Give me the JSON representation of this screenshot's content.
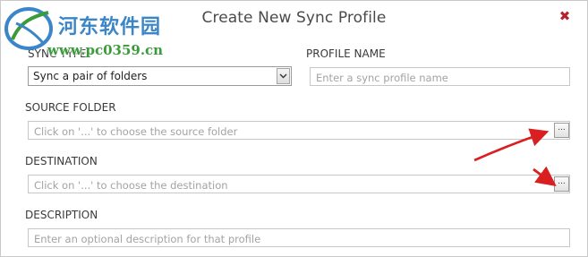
{
  "window": {
    "title": "Create New Sync Profile",
    "close_glyph": "✖"
  },
  "sync_type": {
    "label": "SYNC TYPE",
    "selected": "Sync a pair of folders"
  },
  "profile_name": {
    "label": "PROFILE NAME",
    "placeholder": "Enter a sync profile name",
    "value": ""
  },
  "source_folder": {
    "label": "SOURCE FOLDER",
    "placeholder": "Click on '...' to choose the source folder",
    "value": "",
    "browse_label": "..."
  },
  "destination": {
    "label": "DESTINATION",
    "placeholder": "Click on '...' to choose the destination",
    "value": "",
    "browse_label": "..."
  },
  "description": {
    "label": "DESCRIPTION",
    "placeholder": "Enter an optional description for that profile",
    "value": ""
  },
  "watermark": {
    "site_name": "河东软件园",
    "url": "www.pc0359.cn"
  },
  "colors": {
    "annotation_arrow": "#d91f1f",
    "close_icon": "#b4232f",
    "watermark_blue": "#3a86c8",
    "watermark_green": "#3a9b3a"
  }
}
